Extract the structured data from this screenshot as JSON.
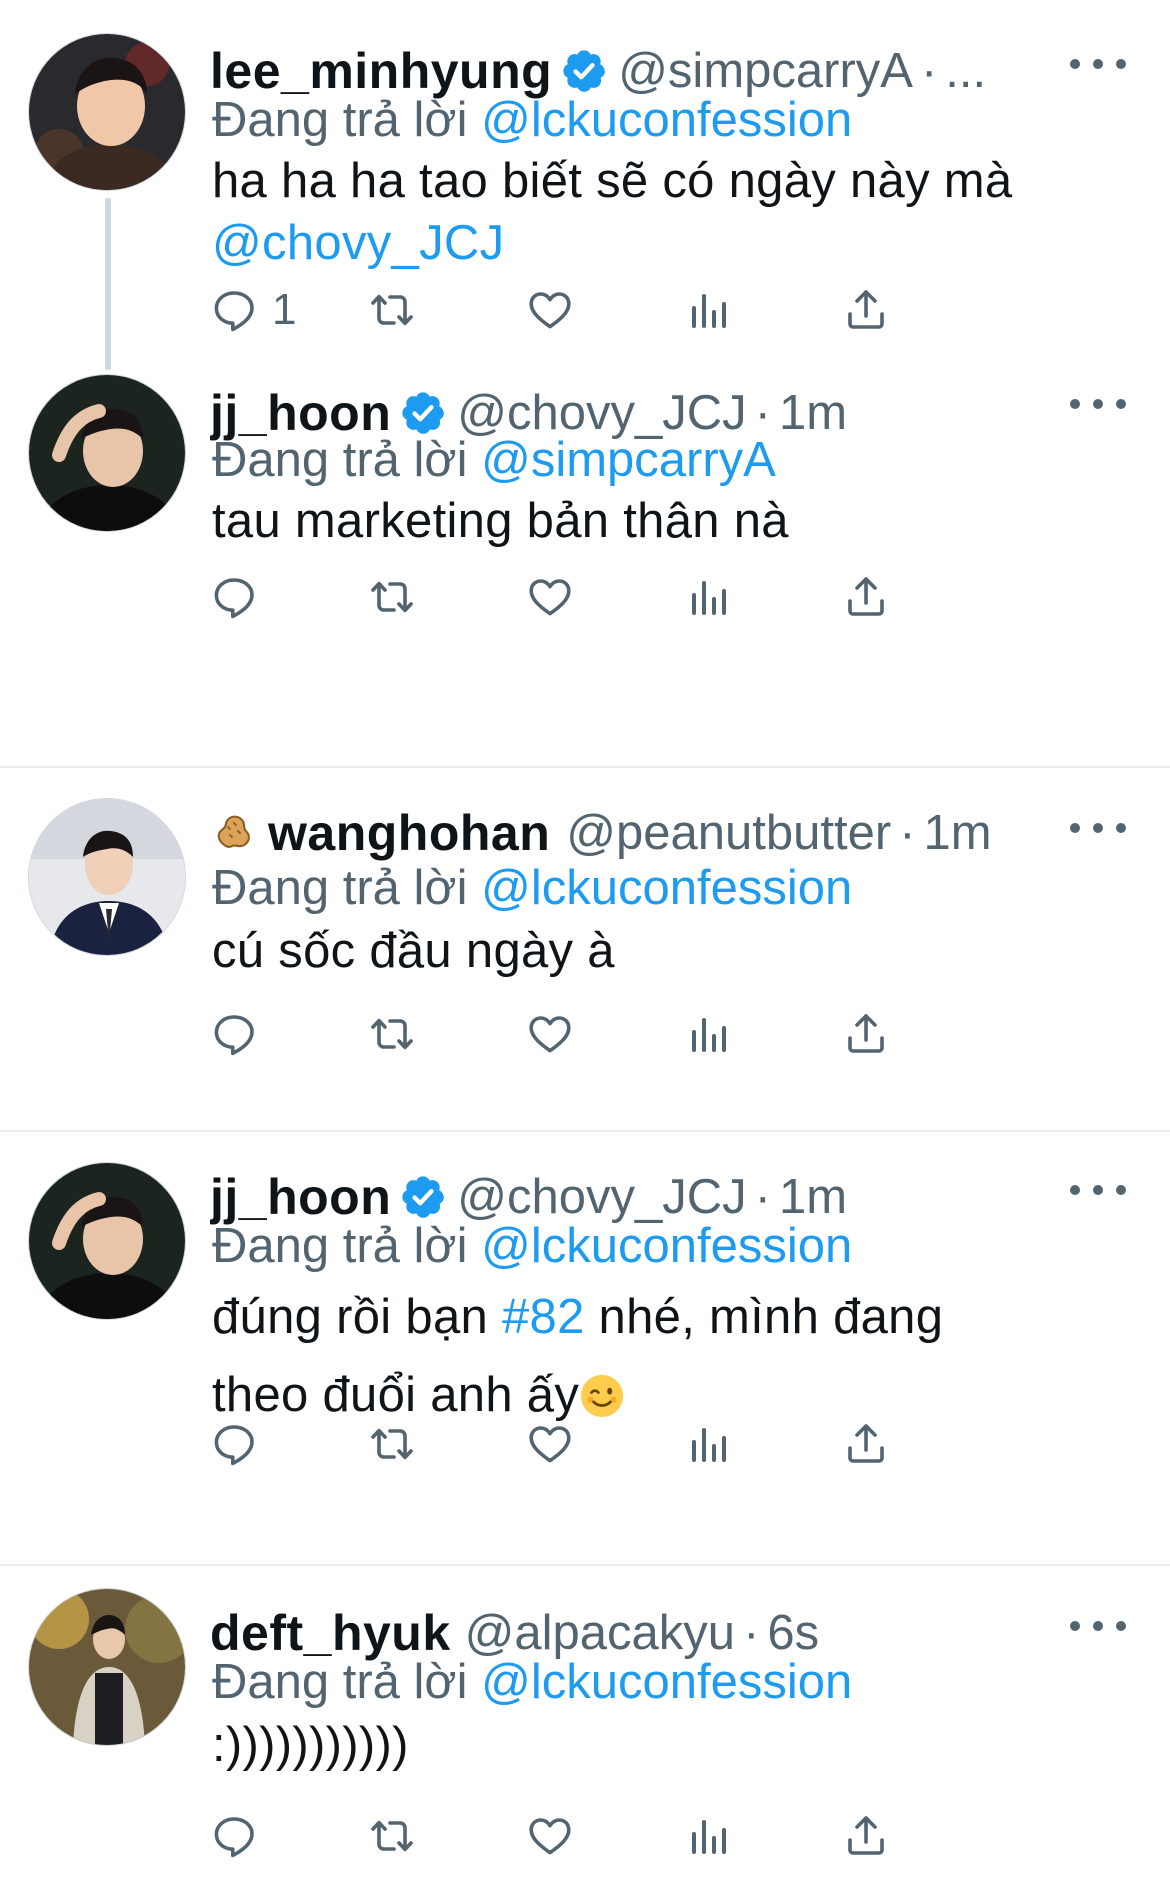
{
  "tweets": [
    {
      "name": "lee_minhyung",
      "verified": true,
      "handle": "@simpcarryA",
      "separator": "·",
      "time": "...",
      "replying_prefix": "Đang trả lời",
      "replying_to": "@lckuconfession",
      "body_text": "ha ha ha tao biết sẽ có ngày này mà",
      "body_mention": "@chovy_JCJ",
      "reply_count": "1"
    },
    {
      "name": "jj_hoon",
      "verified": true,
      "handle": "@chovy_JCJ",
      "separator": "·",
      "time": "1m",
      "replying_prefix": "Đang trả lời",
      "replying_to": "@simpcarryA",
      "body_text": "tau marketing bản thân nà"
    },
    {
      "name_emoji": "peanut-emoji",
      "name": "wanghohan",
      "verified": false,
      "handle": "@peanutbutter",
      "separator": "·",
      "time": "1m",
      "replying_prefix": "Đang trả lời",
      "replying_to": "@lckuconfession",
      "body_text": "cú sốc đầu ngày à"
    },
    {
      "name": "jj_hoon",
      "verified": true,
      "handle": "@chovy_JCJ",
      "separator": "·",
      "time": "1m",
      "replying_prefix": "Đang trả lời",
      "replying_to": "@lckuconfession",
      "body_line1_a": "đúng rồi bạn",
      "body_hashtag": "#82",
      "body_line1_b": "nhé, mình đang",
      "body_line2": "theo đuổi anh ấy",
      "body_emoji": "winking-face-emoji"
    },
    {
      "name": "deft_hyuk",
      "verified": false,
      "handle": "@alpacakyu",
      "separator": "·",
      "time": "6s",
      "replying_prefix": "Đang trả lời",
      "replying_to": "@lckuconfession",
      "body_text": ":)))))))))))"
    }
  ],
  "icons": {
    "reply": "reply-icon",
    "retweet": "retweet-icon",
    "like": "heart-icon",
    "views": "analytics-icon",
    "share": "share-icon",
    "more": "more-options-icon",
    "verified": "verified-badge-icon"
  },
  "colors": {
    "text": "#0f1419",
    "secondary": "#536471",
    "link": "#1d9bf0",
    "divider": "#e6ecf0"
  }
}
